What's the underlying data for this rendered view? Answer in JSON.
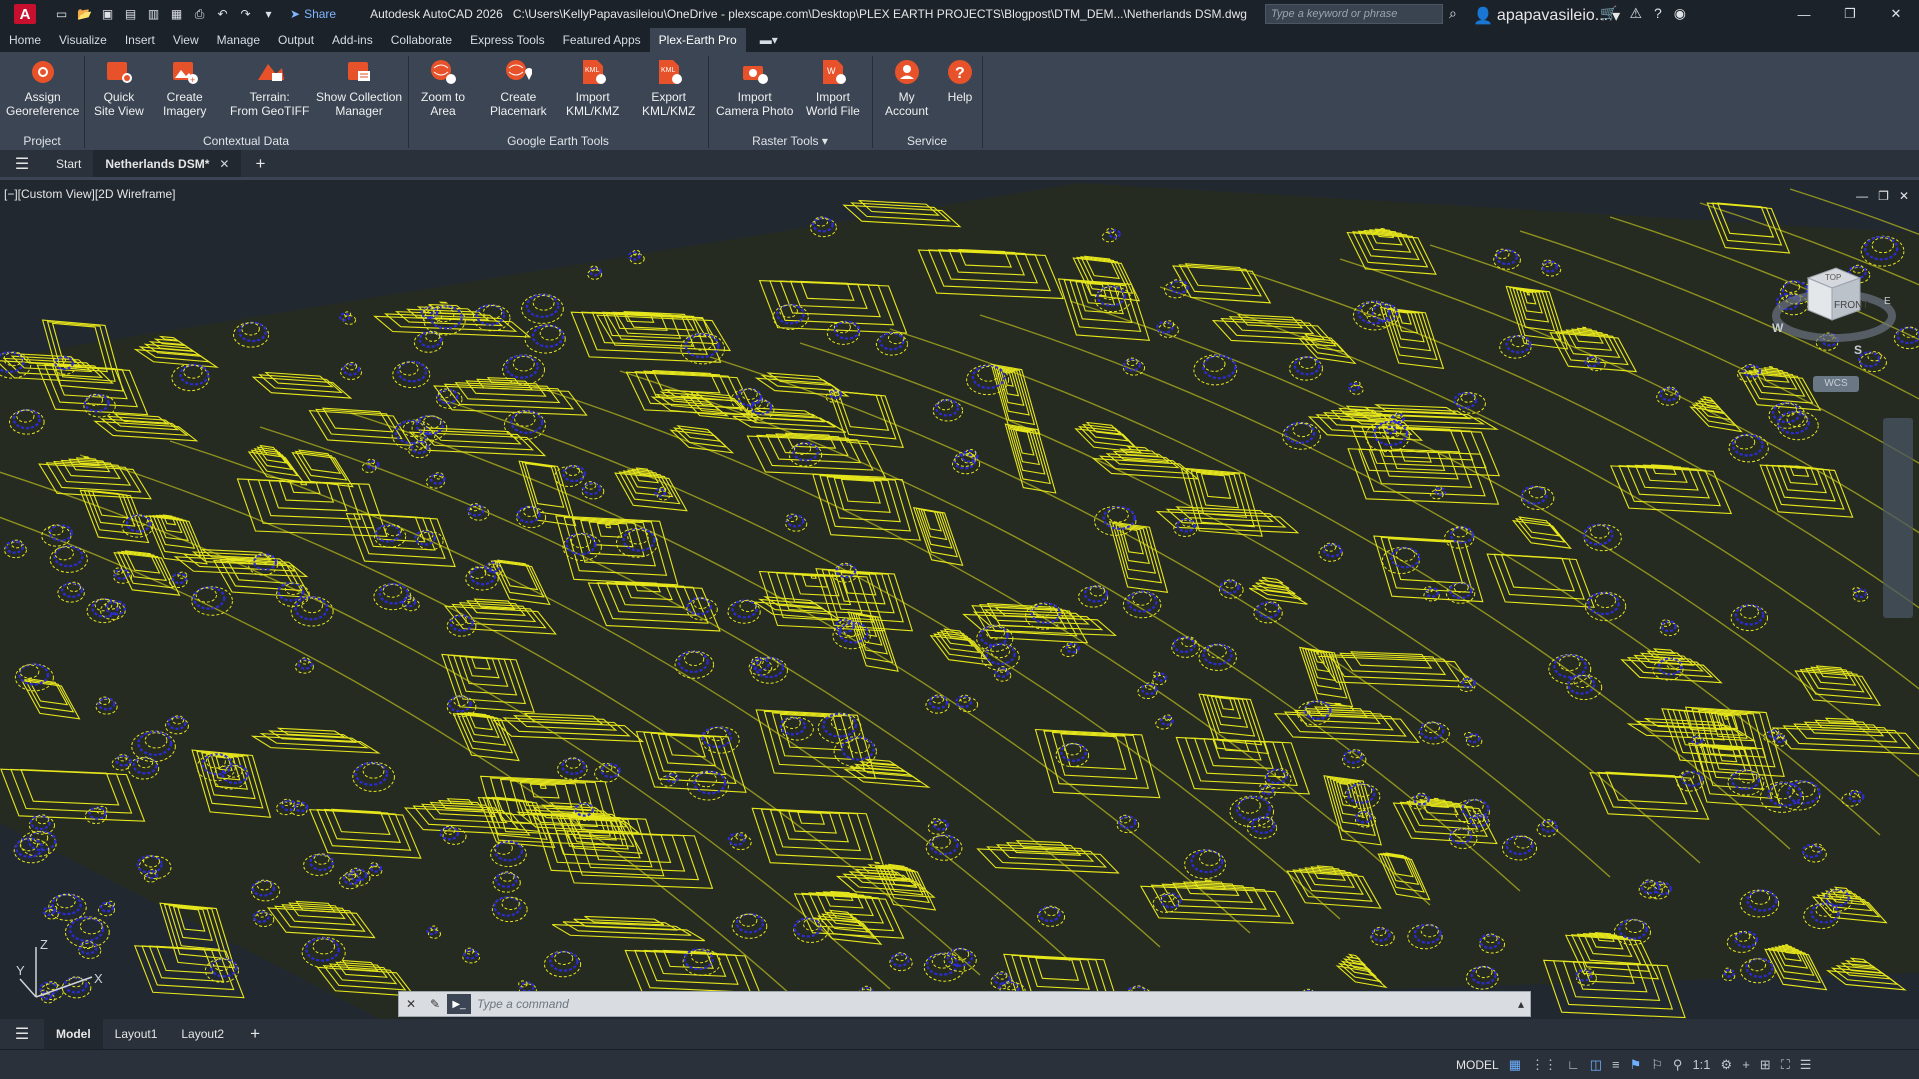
{
  "titlebar": {
    "app_letter": "A",
    "share_label": "Share",
    "app_title": "Autodesk AutoCAD 2026",
    "file_path": "C:\\Users\\KellyPapavasileiou\\OneDrive - plexscape.com\\Desktop\\PLEX EARTH PROJECTS\\Blogpost\\DTM_DEM...\\Netherlands DSM.dwg",
    "search_placeholder": "Type a keyword or phrase",
    "username": "apapavasileio..."
  },
  "menu_tabs": [
    "Home",
    "Visualize",
    "Insert",
    "View",
    "Manage",
    "Output",
    "Add-ins",
    "Collaborate",
    "Express Tools",
    "Featured Apps",
    "Plex-Earth Pro"
  ],
  "active_menu_tab": "Plex-Earth Pro",
  "ribbon": {
    "buttons": [
      {
        "line1": "Assign",
        "line2": "Georeference"
      },
      {
        "line1": "Quick",
        "line2": "Site View"
      },
      {
        "line1": "Create",
        "line2": "Imagery"
      },
      {
        "line1": "Terrain:",
        "line2": "From GeoTIFF"
      },
      {
        "line1": "Show Collection",
        "line2": "Manager"
      },
      {
        "line1": "Zoom to",
        "line2": "Area"
      },
      {
        "line1": "Create",
        "line2": "Placemark"
      },
      {
        "line1": "Import",
        "line2": "KML/KMZ"
      },
      {
        "line1": "Export",
        "line2": "KML/KMZ"
      },
      {
        "line1": "Import",
        "line2": "Camera Photo"
      },
      {
        "line1": "Import",
        "line2": "World File"
      },
      {
        "line1": "My",
        "line2": "Account"
      },
      {
        "line1": "Help",
        "line2": ""
      }
    ],
    "panels": [
      "Project",
      "Contextual Data",
      "Google Earth Tools",
      "Raster Tools",
      "Service"
    ]
  },
  "file_tabs": {
    "start": "Start",
    "active": "Netherlands DSM*"
  },
  "viewport": {
    "view_label": "[−][Custom View][2D Wireframe]",
    "viewcube": {
      "top": "TOP",
      "front": "FRONT",
      "west": "W",
      "south": "S",
      "east": "E"
    },
    "wcs_label": "WCS",
    "ucs": {
      "x": "X",
      "y": "Y",
      "z": "Z"
    },
    "contour_colors": {
      "primary": "#e6e61c",
      "secondary": "#2b2bd6"
    }
  },
  "command_line": {
    "placeholder": "Type a command"
  },
  "layout_tabs": [
    "Model",
    "Layout1",
    "Layout2"
  ],
  "active_layout_tab": "Model",
  "statusbar": {
    "mode": "MODEL",
    "scale": "1:1"
  }
}
